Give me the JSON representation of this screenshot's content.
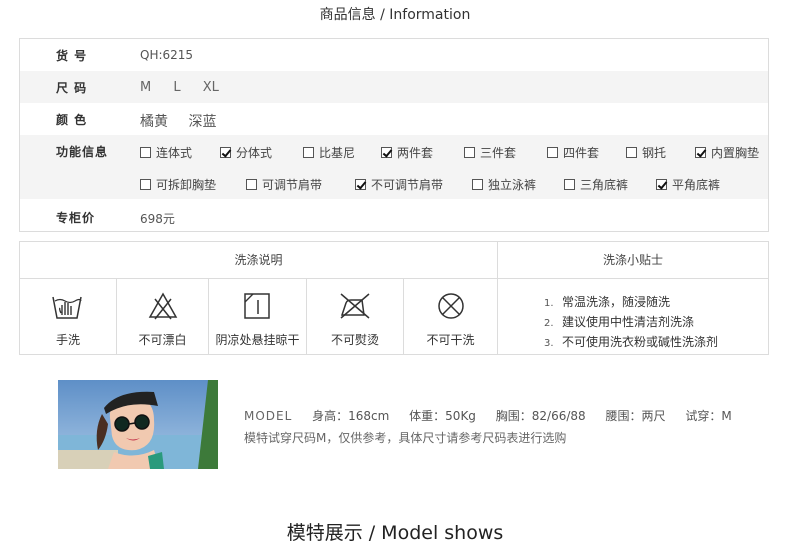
{
  "title": "商品信息 / Information",
  "info": {
    "item_no_label": "货  号",
    "item_no": "QH:6215",
    "size_label": "尺  码",
    "sizes": [
      "M",
      "L",
      "XL"
    ],
    "color_label": "颜  色",
    "colors": [
      "橘黄",
      "深蓝"
    ],
    "func_label": "功能信息",
    "features_row1": [
      {
        "label": "连体式",
        "checked": false
      },
      {
        "label": "分体式",
        "checked": true
      },
      {
        "label": "比基尼",
        "checked": false
      },
      {
        "label": "两件套",
        "checked": true
      },
      {
        "label": "三件套",
        "checked": false
      },
      {
        "label": "四件套",
        "checked": false
      },
      {
        "label": "钢托",
        "checked": false
      },
      {
        "label": "内置胸垫",
        "checked": true
      }
    ],
    "features_row2": [
      {
        "label": "可拆卸胸垫",
        "checked": false
      },
      {
        "label": "可调节肩带",
        "checked": false
      },
      {
        "label": "不可调节肩带",
        "checked": true
      },
      {
        "label": "独立泳裤",
        "checked": false
      },
      {
        "label": "三角底裤",
        "checked": false
      },
      {
        "label": "平角底裤",
        "checked": true
      }
    ],
    "price_label": "专柜价",
    "price": "698元"
  },
  "wash": {
    "header_left": "洗涤说明",
    "header_right": "洗涤小贴士",
    "icons": [
      {
        "icon": "hand-wash-icon",
        "label": "手洗"
      },
      {
        "icon": "no-bleach-icon",
        "label": "不可漂白"
      },
      {
        "icon": "line-dry-shade-icon",
        "label": "阴凉处悬挂晾干"
      },
      {
        "icon": "no-iron-icon",
        "label": "不可熨烫"
      },
      {
        "icon": "no-dry-clean-icon",
        "label": "不可干洗"
      }
    ],
    "tips": [
      {
        "n": "1.",
        "text": "常温洗涤，随浸随洗"
      },
      {
        "n": "2.",
        "text": "建议使用中性清洁剂洗涤"
      },
      {
        "n": "3.",
        "text": "不可使用洗衣粉或碱性洗涤剂"
      }
    ]
  },
  "model": {
    "model_label": "MODEL",
    "height": "身高：168cm",
    "weight": "体重：50Kg",
    "bust": "胸围：82/66/88",
    "waist": "腰围：两尺",
    "try_size": "试穿：M",
    "note": "模特试穿尺码M，仅供参考，具体尺寸请参考尺码表进行选购"
  },
  "bottom_title": "模特展示 / Model  shows"
}
